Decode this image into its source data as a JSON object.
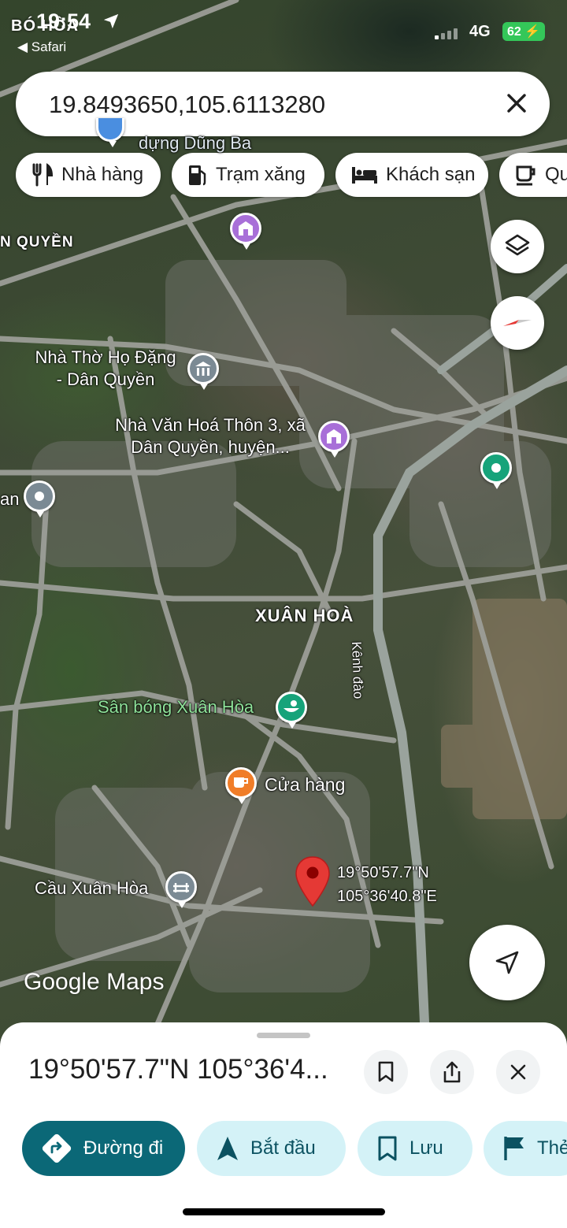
{
  "status_bar": {
    "time": "19:54",
    "location_overlay": "BÓ HÒA",
    "back_app": "◀ Safari",
    "network": "4G",
    "battery": "62"
  },
  "search": {
    "query": "19.8493650,105.6113280"
  },
  "chips": [
    {
      "label": "Nhà hàng",
      "icon": "fork-knife-icon"
    },
    {
      "label": "Trạm xăng",
      "icon": "gas-station-icon"
    },
    {
      "label": "Khách sạn",
      "icon": "bed-icon"
    },
    {
      "label": "Qu",
      "icon": "coffee-cup-icon"
    }
  ],
  "map": {
    "labels": {
      "top_partial": "dựng Dũng Ba",
      "left_area": "N QUYỀN",
      "church_line1": "Nhà Thờ Họ Đặng",
      "church_line2": "- Dân Quyền",
      "culture_line1": "Nhà Văn Hoá Thôn 3, xã",
      "culture_line2": "Dân Quyền, huyện...",
      "left_partial": "an",
      "village": "XUÂN HOÀ",
      "canal": "Kênh đào",
      "stadium": "Sân bóng Xuân Hòa",
      "shop": "Cửa hàng",
      "bridge": "Cầu Xuân Hòa",
      "pin_lat": "19°50'57.7\"N",
      "pin_lon": "105°36'40.8\"E"
    },
    "logo_google": "Google",
    "logo_maps": "Maps",
    "colors": {
      "poi_purple": "#a86fd8",
      "poi_gray": "#7b8a94",
      "poi_teal": "#16a37a",
      "poi_orange": "#f07d28",
      "pin_red": "#e53935"
    }
  },
  "sheet": {
    "title": "19°50'57.7\"N 105°36'4...",
    "actions": [
      {
        "label": "Đường đi",
        "icon": "directions-icon"
      },
      {
        "label": "Bắt đầu",
        "icon": "navigation-arrow-icon"
      },
      {
        "label": "Lưu",
        "icon": "bookmark-icon"
      },
      {
        "label": "Thẻ",
        "icon": "flag-icon"
      }
    ]
  }
}
